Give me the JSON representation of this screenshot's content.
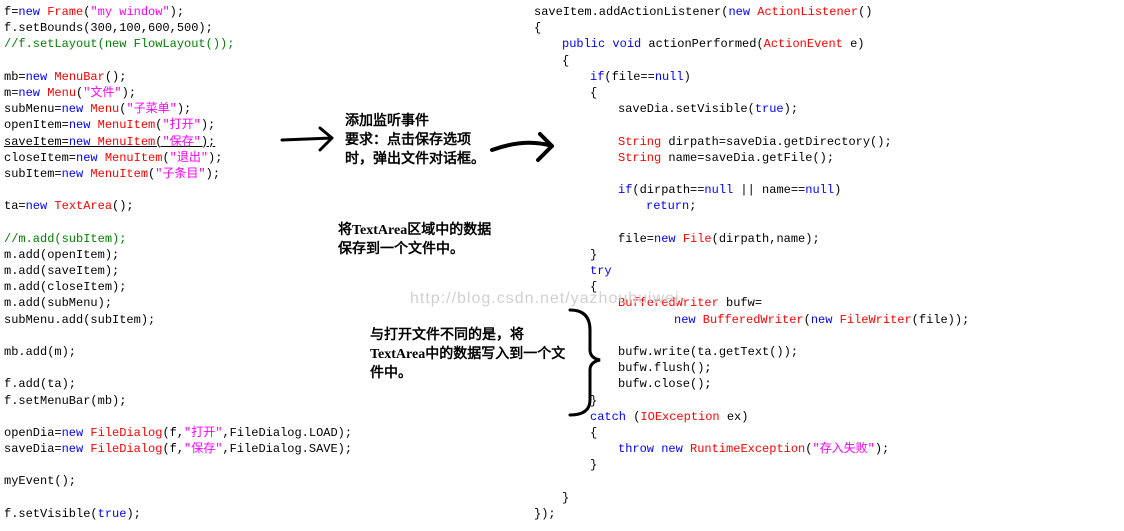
{
  "left": {
    "l1a": "f=",
    "l1b": "new",
    "l1c": " Frame",
    "l1d": "(",
    "l1e": "\"my window\"",
    "l1f": ");",
    "l2": "f.setBounds(300,100,600,500);",
    "l3": "//f.setLayout(new FlowLayout());",
    "l4a": "mb=",
    "l4b": "new",
    "l4c": " MenuBar",
    "l4d": "();",
    "l5a": "m=",
    "l5b": "new",
    "l5c": " Menu",
    "l5d": "(",
    "l5e": "\"文件\"",
    "l5f": ");",
    "l6a": "subMenu=",
    "l6b": "new",
    "l6c": " Menu",
    "l6d": "(",
    "l6e": "\"子菜单\"",
    "l6f": ");",
    "l7a": "openItem=",
    "l7b": "new",
    "l7c": " MenuItem",
    "l7d": "(",
    "l7e": "\"打开\"",
    "l7f": ");",
    "l8a": "saveItem=",
    "l8b": "new",
    "l8c": " MenuItem",
    "l8d": "(",
    "l8e": "\"保存\"",
    "l8f": ");",
    "l9a": "closeItem=",
    "l9b": "new",
    "l9c": " MenuItem",
    "l9d": "(",
    "l9e": "\"退出\"",
    "l9f": ");",
    "l10a": "subItem=",
    "l10b": "new",
    "l10c": " MenuItem",
    "l10d": "(",
    "l10e": "\"子条目\"",
    "l10f": ");",
    "l11a": "ta=",
    "l11b": "new",
    "l11c": " TextArea",
    "l11d": "();",
    "l12": "//m.add(subItem);",
    "l13": "m.add(openItem);",
    "l14": "m.add(saveItem);",
    "l15": "m.add(closeItem);",
    "l16": "m.add(subMenu);",
    "l17": "subMenu.add(subItem);",
    "l18": "mb.add(m);",
    "l19": "f.add(ta);",
    "l20": "f.setMenuBar(mb);",
    "l21a": "openDia=",
    "l21b": "new",
    "l21c": " FileDialog",
    "l21d": "(f,",
    "l21e": "\"打开\"",
    "l21f": ",FileDialog.LOAD);",
    "l22a": "saveDia=",
    "l22b": "new",
    "l22c": " FileDialog",
    "l22d": "(f,",
    "l22e": "\"保存\"",
    "l22f": ",FileDialog.SAVE);",
    "l23": "myEvent();",
    "l24a": "f.setVisible(",
    "l24b": "true",
    "l24c": ");"
  },
  "right": {
    "r1a": "saveItem.addActionListener(",
    "r1b": "new",
    "r1c": " ActionListener",
    "r1d": "()",
    "r2": "{",
    "r3a": "public",
    "r3b": " void",
    "r3c": " actionPerformed(",
    "r3d": "ActionEvent",
    "r3e": " e)",
    "r4": "{",
    "r5a": "if",
    "r5b": "(file==",
    "r5c": "null",
    "r5d": ")",
    "r6": "{",
    "r7a": "saveDia.setVisible(",
    "r7b": "true",
    "r7c": ");",
    "r8a": "String",
    "r8b": " dirpath=saveDia.getDirectory();",
    "r9a": "String",
    "r9b": " name=saveDia.getFile();",
    "r10a": "if",
    "r10b": "(dirpath==",
    "r10c": "null",
    "r10d": " || name==",
    "r10e": "null",
    "r10f": ")",
    "r11": "return",
    "r11b": ";",
    "r12a": "file=",
    "r12b": "new",
    "r12c": " File",
    "r12d": "(dirpath,name);",
    "r13": "}",
    "r14": "try",
    "r15": "{",
    "r16a": "BufferedWriter",
    "r16b": " bufw=",
    "r17a": "new",
    "r17b": " BufferedWriter",
    "r17c": "(",
    "r17d": "new",
    "r17e": " FileWriter",
    "r17f": "(file));",
    "r18": "bufw.write(ta.getText());",
    "r19": "bufw.flush();",
    "r20": "bufw.close();",
    "r21": "}",
    "r22a": "catch",
    "r22b": " (",
    "r22c": "IOException",
    "r22d": " ex)",
    "r23": "{",
    "r24a": "throw",
    "r24b": " new",
    "r24c": " RuntimeException",
    "r24d": "(",
    "r24e": "\"存入失败\"",
    "r24f": ");",
    "r25": "}",
    "r26": "}",
    "r27": "});"
  },
  "anno": {
    "a1": "添加监听事件",
    "a2": "要求：点击保存选项时，弹出文件对话框。",
    "a3": "将TextArea区域中的数据保存到一个文件中。",
    "a4": "与打开文件不同的是，将TextArea中的数据写入到一个文件中。"
  },
  "watermark": "http://blog.csdn.net/yazhouhuiwei"
}
